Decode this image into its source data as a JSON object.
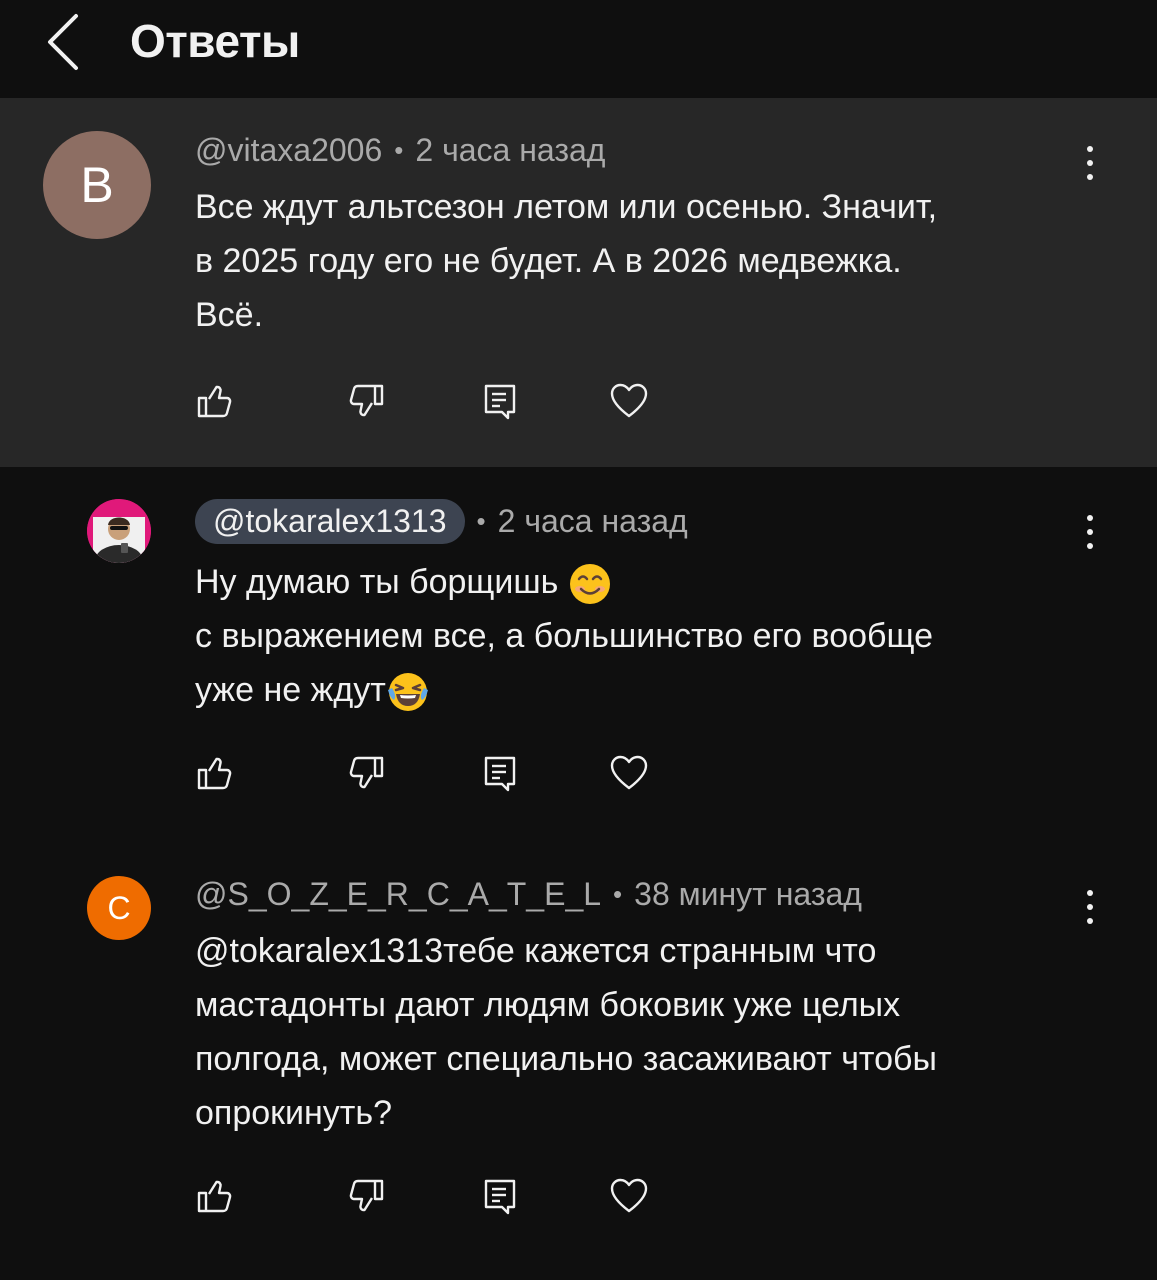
{
  "header": {
    "title": "Ответы",
    "back_icon": "chevron-left-icon"
  },
  "comments": [
    {
      "avatar_letter": "B",
      "avatar_color": "#8d6e63",
      "handle": "@vitaxa2006",
      "time": "2 часа назад",
      "text_lines": [
        "Все ждут альтсезон летом или осенью. Значит,",
        "в 2025 году его не будет. А в 2026 медвежка.",
        "Всё."
      ]
    },
    {
      "avatar_color": "#e0197a",
      "handle": "@tokaralex1313",
      "time": "2 часа назад",
      "text_lines": [
        "Ну думаю ты борщишь ",
        "с выражением все, а большинство его вообще",
        "уже не ждут"
      ]
    },
    {
      "avatar_letter": "C",
      "avatar_color": "#ef6c00",
      "handle": "@S_O_Z_E_R_C_A_T_E_L",
      "time": "38 минут назад",
      "text_lines": [
        "@tokaralex1313тебе кажется странным что",
        "мастадонты дают людям боковик уже целых",
        "полгода, может специально засаживают чтобы",
        "опрокинуть?"
      ]
    }
  ],
  "icons": {
    "like": "thumbs-up-icon",
    "dislike": "thumbs-down-icon",
    "reply": "reply-comment-icon",
    "heart": "heart-icon",
    "menu": "more-vertical-icon"
  },
  "colors": {
    "background": "#0f0f0f",
    "highlight": "#272727",
    "secondary_text": "#aaaaaa",
    "chip": "#3d4451"
  }
}
